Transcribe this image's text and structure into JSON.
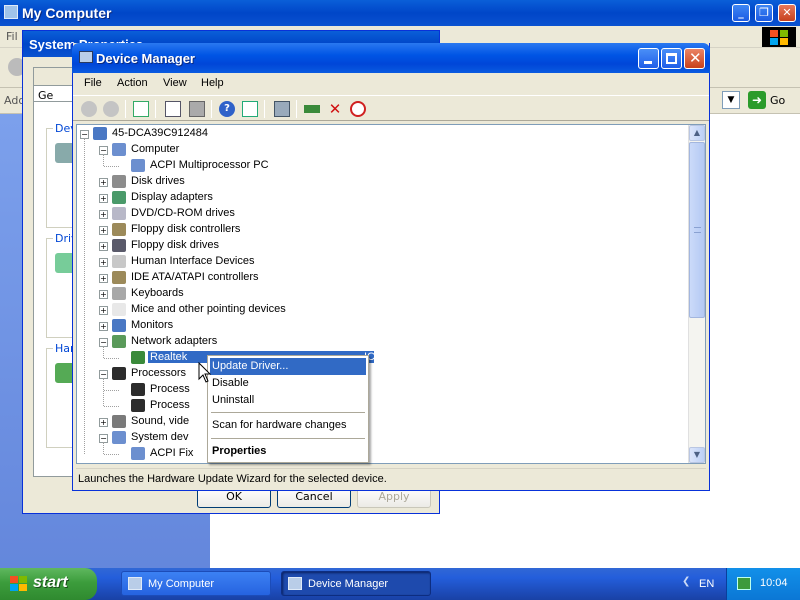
{
  "background_window": {
    "title": "My Computer",
    "menu_first": "Fil",
    "address_label": "Add",
    "go_label": "Go"
  },
  "system_properties": {
    "title": "System Properties",
    "tab_label": "Ge",
    "group_labels": [
      "Dev",
      "Driv",
      "Har"
    ],
    "buttons": {
      "ok": "OK",
      "cancel": "Cancel",
      "apply": "Apply"
    }
  },
  "device_manager": {
    "title": "Device Manager",
    "menu": [
      "File",
      "Action",
      "View",
      "Help"
    ],
    "toolbar_icons": [
      "back-icon",
      "forward-icon",
      "console-tree-icon",
      "properties-icon",
      "print-icon",
      "help-icon",
      "show-hide-icon",
      "scan-hardware-icon",
      "update-driver-icon",
      "uninstall-icon",
      "disable-icon"
    ],
    "tree": [
      {
        "label": "45-DCA39C912484",
        "depth": 0,
        "expander": "-",
        "icon": "computer-root-icon"
      },
      {
        "label": "Computer",
        "depth": 1,
        "expander": "-",
        "icon": "computer-icon"
      },
      {
        "label": "ACPI Multiprocessor PC",
        "depth": 2,
        "expander": "",
        "icon": "computer-icon"
      },
      {
        "label": "Disk drives",
        "depth": 1,
        "expander": "+",
        "icon": "disk-drive-icon"
      },
      {
        "label": "Display adapters",
        "depth": 1,
        "expander": "+",
        "icon": "display-adapter-icon"
      },
      {
        "label": "DVD/CD-ROM drives",
        "depth": 1,
        "expander": "+",
        "icon": "cdrom-icon"
      },
      {
        "label": "Floppy disk controllers",
        "depth": 1,
        "expander": "+",
        "icon": "floppy-controller-icon"
      },
      {
        "label": "Floppy disk drives",
        "depth": 1,
        "expander": "+",
        "icon": "floppy-drive-icon"
      },
      {
        "label": "Human Interface Devices",
        "depth": 1,
        "expander": "+",
        "icon": "hid-icon"
      },
      {
        "label": "IDE ATA/ATAPI controllers",
        "depth": 1,
        "expander": "+",
        "icon": "ide-controller-icon"
      },
      {
        "label": "Keyboards",
        "depth": 1,
        "expander": "+",
        "icon": "keyboard-icon"
      },
      {
        "label": "Mice and other pointing devices",
        "depth": 1,
        "expander": "+",
        "icon": "mouse-icon"
      },
      {
        "label": "Monitors",
        "depth": 1,
        "expander": "+",
        "icon": "monitor-icon"
      },
      {
        "label": "Network adapters",
        "depth": 1,
        "expander": "-",
        "icon": "network-adapter-icon"
      },
      {
        "label": "Realtek",
        "tail": "IC",
        "depth": 2,
        "expander": "",
        "icon": "network-card-icon",
        "selected": true
      },
      {
        "label": "Processors",
        "depth": 1,
        "expander": "-",
        "icon": "processor-icon"
      },
      {
        "label": "Process",
        "depth": 2,
        "expander": "",
        "icon": "processor-icon"
      },
      {
        "label": "Process",
        "depth": 2,
        "expander": "",
        "icon": "processor-icon"
      },
      {
        "label": "Sound, vide",
        "depth": 1,
        "expander": "+",
        "icon": "sound-icon"
      },
      {
        "label": "System dev",
        "depth": 1,
        "expander": "-",
        "icon": "system-device-icon"
      },
      {
        "label": "ACPI Fix",
        "depth": 2,
        "expander": "",
        "icon": "system-device-icon"
      }
    ],
    "status_text": "Launches the Hardware Update Wizard for the selected device."
  },
  "context_menu": {
    "items": [
      {
        "label": "Update Driver...",
        "highlighted": true
      },
      {
        "label": "Disable"
      },
      {
        "label": "Uninstall"
      },
      {
        "separator": true
      },
      {
        "label": "Scan for hardware changes"
      },
      {
        "separator": true
      },
      {
        "label": "Properties",
        "bold": true
      }
    ]
  },
  "taskbar": {
    "start_label": "start",
    "tasks": [
      {
        "label": "My Computer",
        "active": false
      },
      {
        "label": "Device Manager",
        "active": true
      }
    ],
    "language": "EN",
    "clock": "10:04"
  },
  "colors": {
    "xp_blue": "#0046c8",
    "selection": "#316ac5",
    "start_green": "#3c9c3c",
    "dialog_bg": "#ece9d8"
  }
}
